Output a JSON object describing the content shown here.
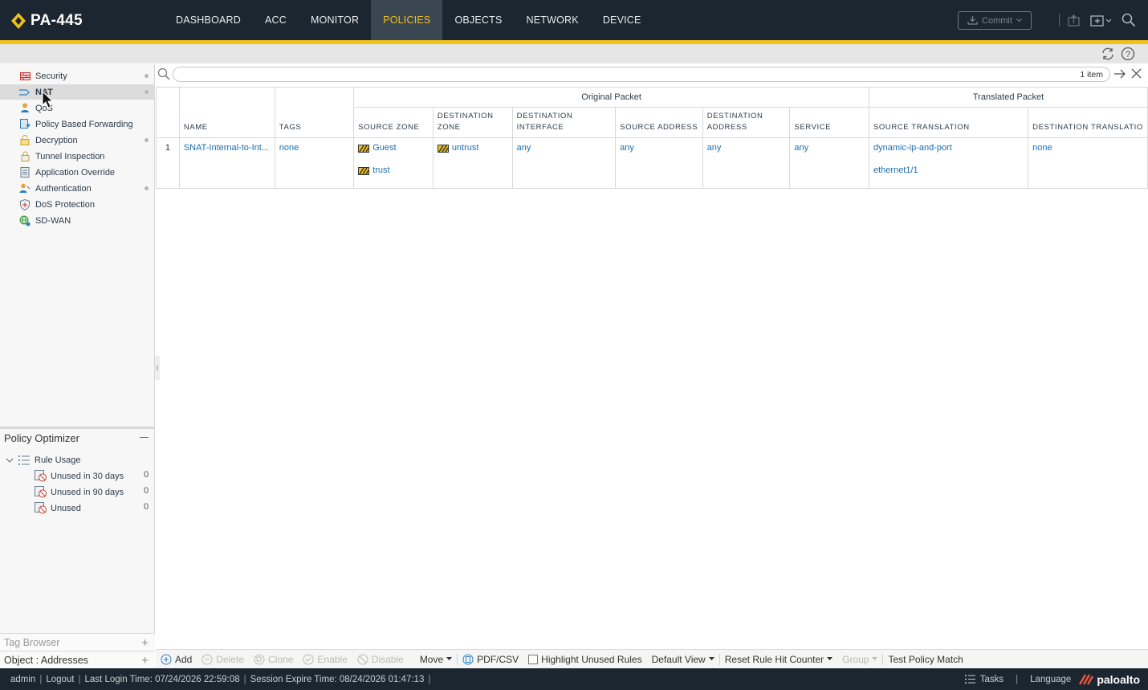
{
  "app": {
    "title": "PA-445",
    "accent_color": "#f1c21b",
    "nav_tabs": [
      {
        "label": "DASHBOARD"
      },
      {
        "label": "ACC"
      },
      {
        "label": "MONITOR"
      },
      {
        "label": "POLICIES",
        "active": true
      },
      {
        "label": "OBJECTS"
      },
      {
        "label": "NETWORK"
      },
      {
        "label": "DEVICE"
      }
    ],
    "commit_label": "Commit"
  },
  "sidebar": {
    "items": [
      {
        "label": "Security",
        "icon": "security-rule-icon",
        "dot": true
      },
      {
        "label": "NAT",
        "icon": "nat-icon",
        "dot": true,
        "active": true
      },
      {
        "label": "QoS",
        "icon": "qos-icon"
      },
      {
        "label": "Policy Based Forwarding",
        "icon": "pbf-icon"
      },
      {
        "label": "Decryption",
        "icon": "decryption-icon",
        "dot": true
      },
      {
        "label": "Tunnel Inspection",
        "icon": "tunnel-icon"
      },
      {
        "label": "Application Override",
        "icon": "app-override-icon"
      },
      {
        "label": "Authentication",
        "icon": "authentication-icon",
        "dot": true
      },
      {
        "label": "DoS Protection",
        "icon": "dos-icon"
      },
      {
        "label": "SD-WAN",
        "icon": "sdwan-icon"
      }
    ],
    "policy_optimizer": {
      "title": "Policy Optimizer",
      "rule_usage": "Rule Usage",
      "children": [
        {
          "label": "Unused in 30 days",
          "count": "0"
        },
        {
          "label": "Unused in 90 days",
          "count": "0"
        },
        {
          "label": "Unused",
          "count": "0"
        }
      ]
    },
    "tag_browser": "Tag Browser",
    "object_addresses": "Object : Addresses"
  },
  "table": {
    "item_count": "1 item",
    "group_original": "Original Packet",
    "group_translated": "Translated Packet",
    "columns": {
      "name": "NAME",
      "tags": "TAGS",
      "source_zone": "SOURCE ZONE",
      "destination_zone": "DESTINATION ZONE",
      "destination_interface": "DESTINATION INTERFACE",
      "source_address": "SOURCE ADDRESS",
      "destination_address": "DESTINATION ADDRESS",
      "service": "SERVICE",
      "source_translation": "SOURCE TRANSLATION",
      "destination_translation": "DESTINATION TRANSLATIO"
    },
    "rows": [
      {
        "num": "1",
        "name": "SNAT-Internal-to-Int...",
        "tags": "none",
        "source_zone": [
          "Guest",
          "trust"
        ],
        "destination_zone": "untrust",
        "destination_interface": "any",
        "source_address": "any",
        "destination_address": "any",
        "service": "any",
        "source_translation": [
          "dynamic-ip-and-port",
          "ethernet1/1"
        ],
        "destination_translation": "none"
      }
    ]
  },
  "actions": {
    "add": "Add",
    "delete": "Delete",
    "clone": "Clone",
    "enable": "Enable",
    "disable": "Disable",
    "move": "Move",
    "pdf_csv": "PDF/CSV",
    "highlight_unused": "Highlight Unused Rules",
    "default_view": "Default View",
    "reset_counter": "Reset Rule Hit Counter",
    "group": "Group",
    "test_policy": "Test Policy Match"
  },
  "status": {
    "user": "admin",
    "logout": "Logout",
    "last_login": "Last Login Time: 07/24/2026 22:59:08",
    "session_expire": "Session Expire Time: 08/24/2026 01:47:13",
    "tasks": "Tasks",
    "language": "Language",
    "brand": "paloalto"
  }
}
